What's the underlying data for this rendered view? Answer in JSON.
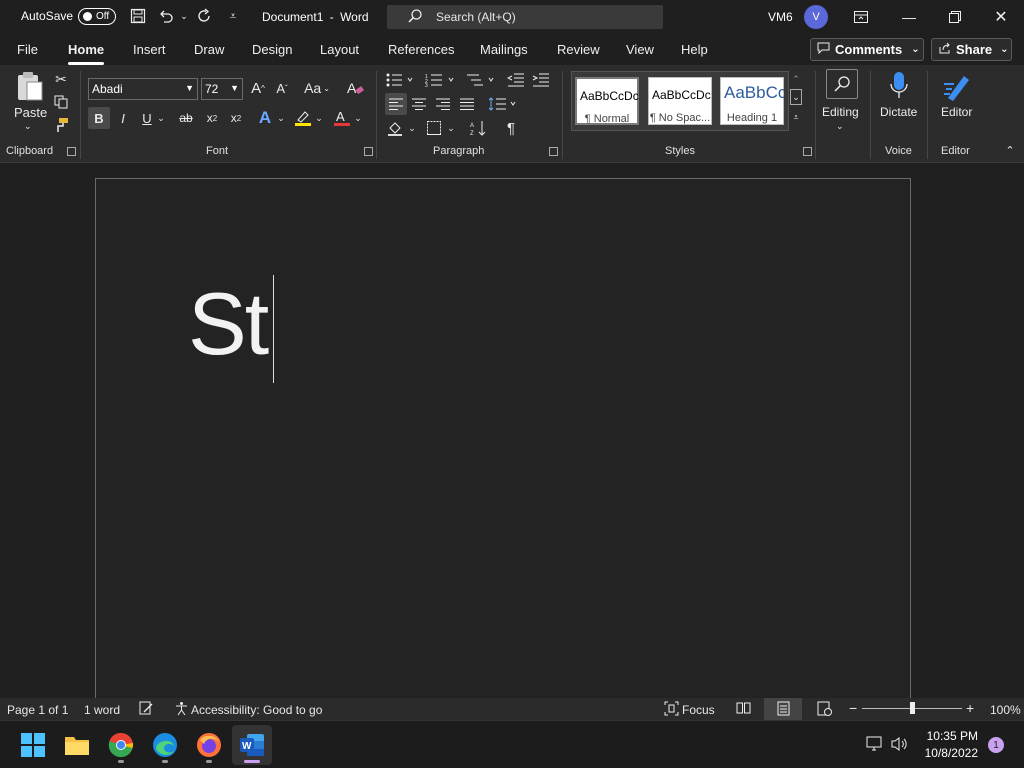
{
  "titlebar": {
    "autosave_label": "AutoSave",
    "autosave_state": "Off",
    "doc_title": "Document1",
    "separator": "-",
    "app_name": "Word",
    "search_placeholder": "Search (Alt+Q)",
    "user_name": "VM6",
    "avatar_initial": "V"
  },
  "menu": {
    "tabs": [
      "File",
      "Home",
      "Insert",
      "Draw",
      "Design",
      "Layout",
      "References",
      "Mailings",
      "Review",
      "View",
      "Help"
    ],
    "active_tab": "Home",
    "comments_label": "Comments",
    "share_label": "Share"
  },
  "ribbon": {
    "clipboard": {
      "paste_label": "Paste",
      "group_label": "Clipboard"
    },
    "font": {
      "font_name": "Abadi",
      "font_size": "72",
      "group_label": "Font",
      "bold": "B",
      "italic": "I",
      "underline": "U",
      "strike": "ab",
      "change_case": "Aa",
      "grow": "A",
      "shrink": "A"
    },
    "paragraph": {
      "group_label": "Paragraph",
      "pilcrow": "¶"
    },
    "styles": {
      "group_label": "Styles",
      "items": [
        {
          "sample": "AaBbCcDc",
          "name": "¶ Normal",
          "selected": true
        },
        {
          "sample": "AaBbCcDc",
          "name": "¶ No Spac...",
          "selected": false
        },
        {
          "sample": "AaBbCc",
          "name": "Heading 1",
          "selected": false
        }
      ]
    },
    "editing_label": "Editing",
    "voice": {
      "dictate_label": "Dictate",
      "group_label": "Voice"
    },
    "editor": {
      "editor_label": "Editor",
      "group_label": "Editor"
    }
  },
  "document": {
    "text": "St"
  },
  "statusbar": {
    "page": "Page 1 of 1",
    "words": "1 word",
    "accessibility": "Accessibility: Good to go",
    "focus": "Focus",
    "zoom": "100%",
    "zoom_level": 1.0
  },
  "taskbar": {
    "time": "10:35 PM",
    "date": "10/8/2022",
    "notification_count": "1"
  },
  "colors": {
    "avatar": "#5b68d8",
    "highlight_yellow": "#ffe600",
    "font_red": "#e53935",
    "word_blue": "#185abd"
  }
}
